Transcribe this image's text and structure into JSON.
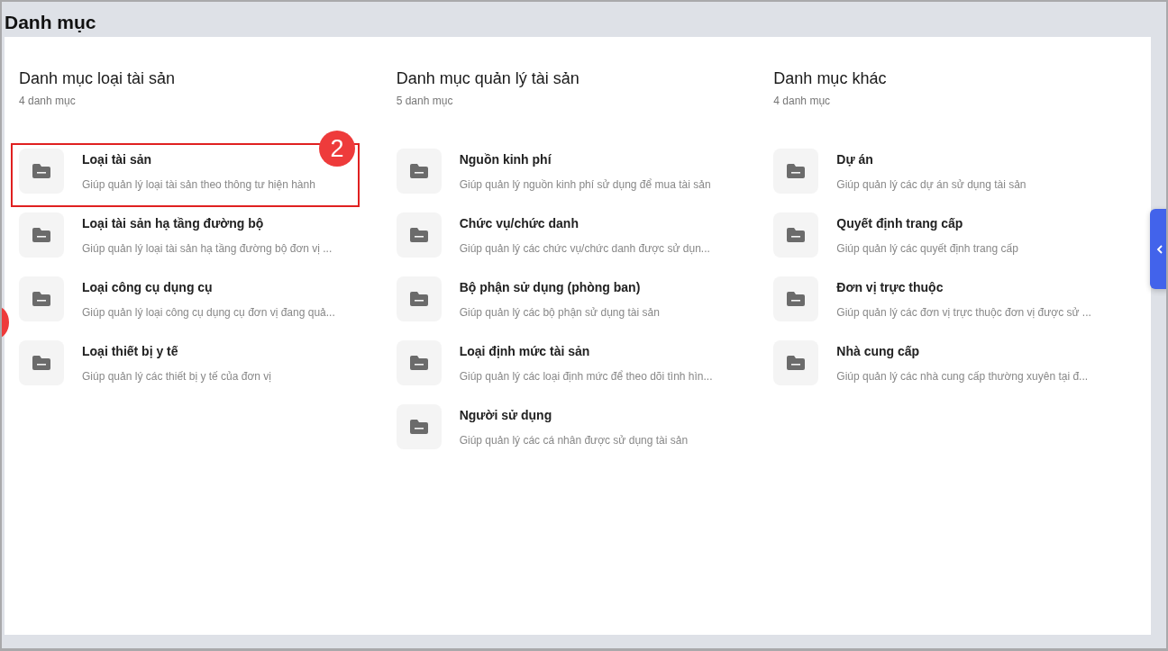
{
  "page": {
    "title": "Danh mục"
  },
  "groups": [
    {
      "title": "Danh mục loại tài sản",
      "count": "4 danh mục",
      "items": [
        {
          "title": "Loại tài sản",
          "description": "Giúp quản lý loại tài sản theo thông tư hiện hành",
          "highlighted": true,
          "callout": "2"
        },
        {
          "title": "Loại tài sản hạ tầng đường bộ",
          "description": "Giúp quản lý loại tài sản hạ tầng đường bộ đơn vị ...",
          "highlighted": false
        },
        {
          "title": "Loại công cụ dụng cụ",
          "description": "Giúp quản lý loại công cụ dụng cụ đơn vị đang quả...",
          "highlighted": false
        },
        {
          "title": "Loại thiết bị y tế",
          "description": "Giúp quản lý các thiết bị y tế của đơn vị",
          "highlighted": false
        }
      ]
    },
    {
      "title": "Danh mục quản lý tài sản",
      "count": "5 danh mục",
      "items": [
        {
          "title": "Nguồn kinh phí",
          "description": "Giúp quản lý nguồn kinh phí sử dụng để mua tài sản",
          "highlighted": false
        },
        {
          "title": "Chức vụ/chức danh",
          "description": "Giúp quản lý các chức vụ/chức danh được sử dụn...",
          "highlighted": false
        },
        {
          "title": "Bộ phận sử dụng (phòng ban)",
          "description": "Giúp quản lý các bộ phận sử dụng tài sản",
          "highlighted": false
        },
        {
          "title": "Loại định mức tài sản",
          "description": "Giúp quản lý các loại định mức để theo dõi tình hìn...",
          "highlighted": false
        },
        {
          "title": "Người sử dụng",
          "description": "Giúp quản lý các cá nhân được sử dụng tài sản",
          "highlighted": false
        }
      ]
    },
    {
      "title": "Danh mục khác",
      "count": "4 danh mục",
      "items": [
        {
          "title": "Dự án",
          "description": "Giúp quản lý các dự án sử dụng tài sản",
          "highlighted": false
        },
        {
          "title": "Quyết định trang cấp",
          "description": "Giúp quản lý các quyết định trang cấp",
          "highlighted": false
        },
        {
          "title": "Đơn vị trực thuộc",
          "description": "Giúp quản lý các đơn vị trực thuộc đơn vị được sử ...",
          "highlighted": false
        },
        {
          "title": "Nhà cung cấp",
          "description": "Giúp quản lý các nhà cung cấp thường xuyên tại đ...",
          "highlighted": false
        }
      ]
    }
  ]
}
